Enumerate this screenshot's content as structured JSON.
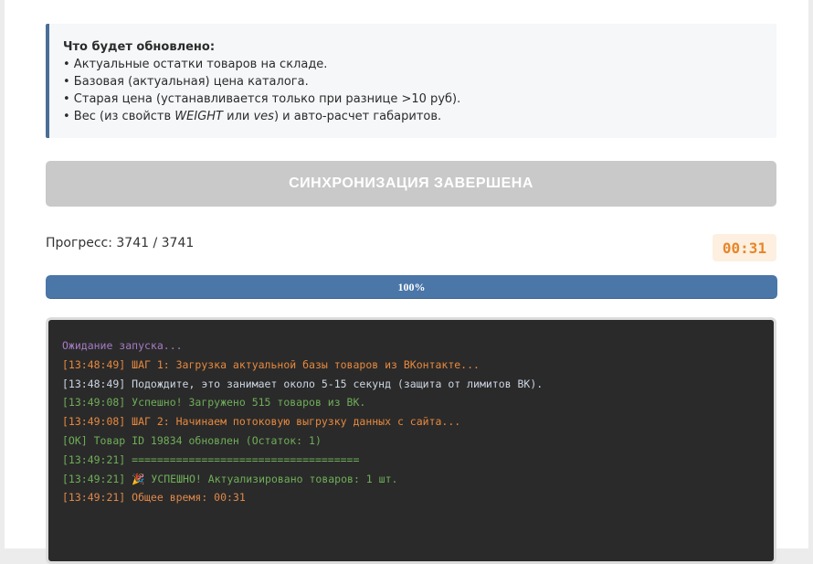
{
  "info": {
    "title": "Что будет обновлено:",
    "items": [
      {
        "text_before": "• Актуальные остатки товаров на складе.",
        "em1": "",
        "mid": "",
        "em2": "",
        "after": ""
      },
      {
        "text_before": "• Базовая (актуальная) цена каталога.",
        "em1": "",
        "mid": "",
        "em2": "",
        "after": ""
      },
      {
        "text_before": "• Старая цена (устанавливается только при разнице >10 руб).",
        "em1": "",
        "mid": "",
        "em2": "",
        "after": ""
      },
      {
        "text_before": "• Вес (из свойств ",
        "em1": "WEIGHT",
        "mid": " или ",
        "em2": "ves",
        "after": ") и авто-расчет габаритов."
      }
    ]
  },
  "sync_button": {
    "label": "СИНХРОНИЗАЦИЯ ЗАВЕРШЕНА"
  },
  "progress": {
    "label": "Прогресс: 3741 / 3741",
    "current": 3741,
    "total": 3741,
    "percent": 100,
    "percent_label": "100%"
  },
  "timer": {
    "value": "00:31"
  },
  "console": {
    "lines": [
      {
        "text": "Ожидание запуска...",
        "color": "#a57bc4"
      },
      {
        "text": "[13:48:49] ШАГ 1: Загрузка актуальной базы товаров из ВКонтакте...",
        "color": "#e8893e"
      },
      {
        "text": "[13:48:49] Подождите, это занимает около 5-15 секунд (защита от лимитов ВК).",
        "color": "#cdd6e2"
      },
      {
        "text": "[13:49:08] Успешно! Загружено 515 товаров из ВК.",
        "color": "#6fae58"
      },
      {
        "text": "[13:49:08] ШАГ 2: Начинаем потоковую выгрузку данных с сайта...",
        "color": "#e8893e"
      },
      {
        "text": "[OK] Товар ID 19834 обновлен (Остаток: 1)",
        "color": "#6fae58"
      },
      {
        "text": "[13:49:21] ====================================",
        "color": "#6fae58"
      },
      {
        "text": "[13:49:21] 🎉 УСПЕШНО! Актуализировано товаров: 1 шт.",
        "color": "#6fae58"
      },
      {
        "text": "[13:49:21] Общее время: 00:31",
        "color": "#e0884a"
      }
    ]
  }
}
